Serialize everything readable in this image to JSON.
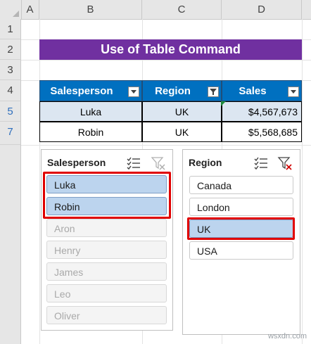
{
  "columns": [
    "A",
    "B",
    "C",
    "D"
  ],
  "rows": [
    "1",
    "2",
    "3",
    "4",
    "5",
    "7"
  ],
  "banner": "Use of Table Command",
  "table": {
    "headers": [
      "Salesperson",
      "Region",
      "Sales"
    ],
    "rows": [
      [
        "Luka",
        "UK",
        "$4,567,673"
      ],
      [
        "Robin",
        "UK",
        "$5,568,685"
      ]
    ]
  },
  "slicer_salesperson": {
    "title": "Salesperson",
    "items": [
      "Luka",
      "Robin",
      "Aron",
      "Henry",
      "James",
      "Leo",
      "Oliver"
    ]
  },
  "slicer_region": {
    "title": "Region",
    "items": [
      "Canada",
      "London",
      "UK",
      "USA"
    ]
  },
  "watermark": "wsxdn.com",
  "colors": {
    "banner": "#7030a0",
    "header": "#0070c0",
    "selected": "#bcd4ee",
    "highlight": "#e00000"
  }
}
